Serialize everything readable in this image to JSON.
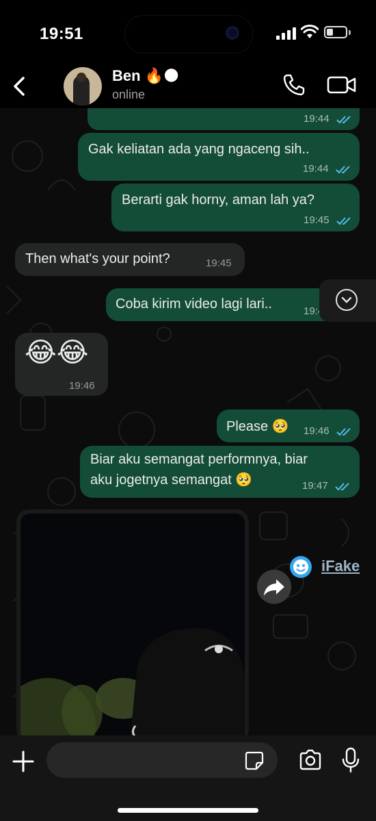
{
  "status_bar": {
    "time": "19:51"
  },
  "header": {
    "contact_name": "Ben",
    "contact_emoji": "🔥🌑",
    "status": "online"
  },
  "messages": [
    {
      "direction": "out",
      "text": "",
      "time": "19:44",
      "kind": "media"
    },
    {
      "direction": "out",
      "text": "Gak keliatan ada yang ngaceng sih..",
      "time": "19:44"
    },
    {
      "direction": "out",
      "text": "Berarti gak horny, aman lah ya?",
      "time": "19:45"
    },
    {
      "direction": "in",
      "text": "Then what's your point?",
      "time": "19:45"
    },
    {
      "direction": "out",
      "text": "Coba kirim video lagi lari..",
      "time": "19:45"
    },
    {
      "direction": "in",
      "text": "😂😂",
      "time": "19:46"
    },
    {
      "direction": "out",
      "text": "Please 🥺",
      "time": "19:46"
    },
    {
      "direction": "out",
      "text_line1": "Biar aku semangat performnya, biar",
      "text_line2": "aku jogetnya semangat 🥺",
      "time": "19:47"
    }
  ],
  "watermark": {
    "text": "iFake"
  },
  "composer": {
    "placeholder": ""
  },
  "colors": {
    "outgoing_bubble": "#144d37",
    "incoming_bubble": "#242626",
    "read_ticks": "#53bdeb"
  },
  "icons": {
    "back": "chevron-left-icon",
    "call": "phone-icon",
    "video": "video-camera-icon",
    "add": "plus-icon",
    "sticker": "sticker-icon",
    "camera": "camera-icon",
    "mic": "microphone-icon",
    "scroll": "chevron-down-icon",
    "forward": "forward-icon"
  }
}
